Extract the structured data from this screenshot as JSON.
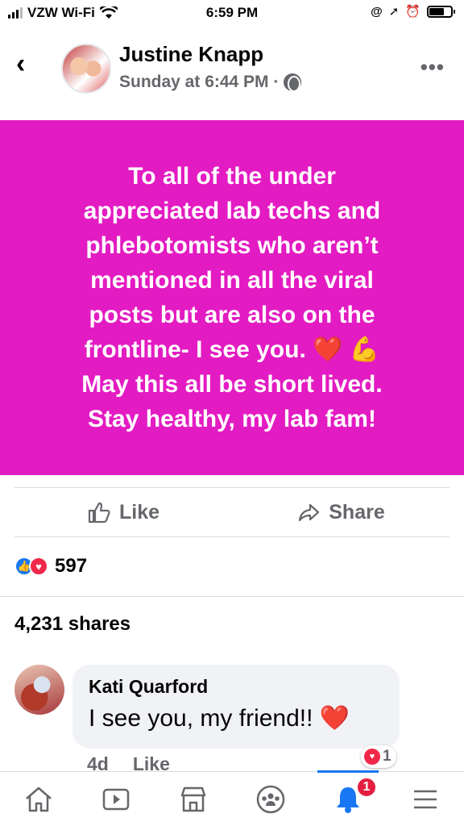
{
  "status_bar": {
    "carrier": "VZW Wi-Fi",
    "time": "6:59 PM"
  },
  "post": {
    "author": "Justine Knapp",
    "timestamp": "Sunday at 6:44 PM ·",
    "text_lines": [
      "To all of the under",
      "appreciated lab techs and",
      "phlebotomists who aren’t",
      "mentioned in all the viral",
      "posts but are also on the",
      "frontline- I see you.",
      "May this all be short lived.",
      "Stay healthy, my lab fam!"
    ],
    "emoji": {
      "heart": "❤️",
      "flexed_biceps": "💪"
    },
    "background_color": "#e31bc2"
  },
  "actions": {
    "like_label": "Like",
    "share_label": "Share"
  },
  "reactions": {
    "count": "597",
    "types": [
      "like",
      "love"
    ]
  },
  "shares": {
    "label": "4,231 shares"
  },
  "comment": {
    "author": "Kati Quarford",
    "text": "I see you, my friend!! ❤️",
    "time": "4d",
    "like_label": "Like",
    "reaction_count": "1"
  },
  "bottom_nav": {
    "items": [
      "home-icon",
      "watch-icon",
      "marketplace-icon",
      "groups-icon",
      "notifications-icon",
      "menu-icon"
    ],
    "notification_badge": "1",
    "accent_color": "#1877f2"
  }
}
